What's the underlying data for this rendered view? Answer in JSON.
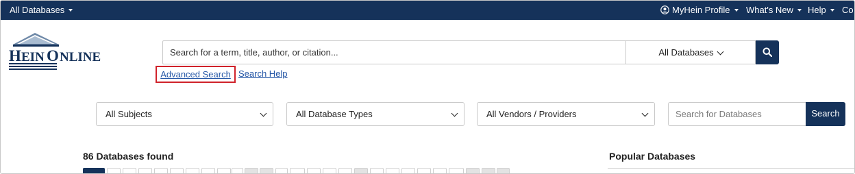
{
  "topbar": {
    "databases_menu": "All Databases",
    "profile_menu": "MyHein Profile",
    "whats_new_menu": "What's New",
    "help_menu": "Help",
    "contact_menu_partial": "Co"
  },
  "logo": {
    "text": "HeinOnline"
  },
  "search": {
    "placeholder": "Search for a term, title, author, or citation...",
    "scope": "All Databases",
    "advanced_link": "Advanced Search",
    "help_link": "Search Help"
  },
  "filters": {
    "subjects": "All Subjects",
    "types": "All Database Types",
    "vendors": "All Vendors / Providers",
    "db_search_placeholder": "Search for Databases",
    "db_search_button": "Search"
  },
  "results": {
    "found_label": "86 Databases found",
    "popular_heading": "Popular Databases"
  },
  "colors": {
    "navy": "#15325a",
    "link": "#2456a6",
    "highlight": "#d0222a"
  }
}
